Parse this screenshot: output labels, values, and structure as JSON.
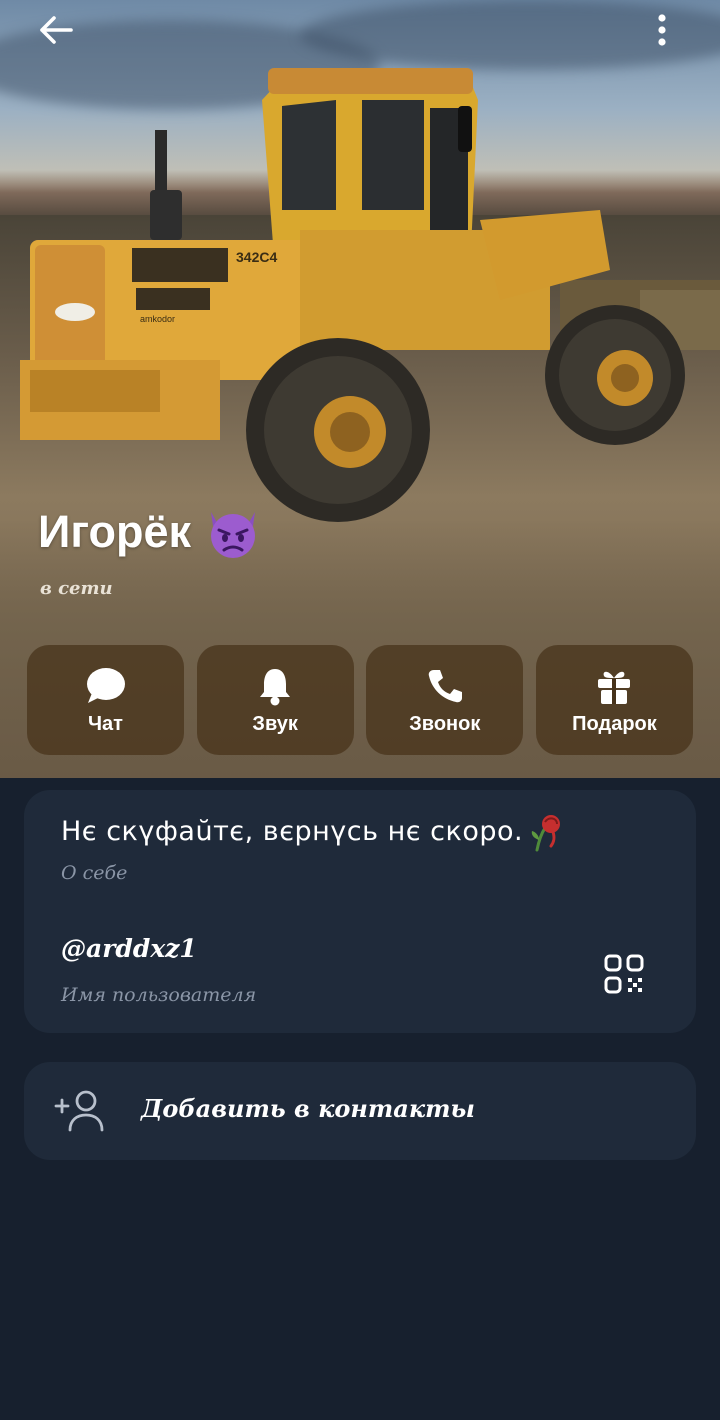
{
  "header": {
    "name": "Игорёк",
    "status": "в сети",
    "loader_plate": "342C4",
    "loader_brand": "amkodor"
  },
  "actions": [
    {
      "label": "Чат",
      "icon": "chat-bubble-icon"
    },
    {
      "label": "Звук",
      "icon": "bell-icon"
    },
    {
      "label": "Звонок",
      "icon": "phone-icon"
    },
    {
      "label": "Подарок",
      "icon": "gift-icon"
    }
  ],
  "about": {
    "bio": "Нє скүфаŭтє, вєрнүсь нє скоро.",
    "bio_caption": "О себе",
    "username": "@arddxz1",
    "username_caption": "Имя пользователя"
  },
  "add_contact": {
    "label": "Добавить в контакты"
  },
  "colors": {
    "background": "#17202e",
    "card": "#1f2a3a",
    "action_button": "#46321a",
    "caption": "#8a95a6"
  }
}
